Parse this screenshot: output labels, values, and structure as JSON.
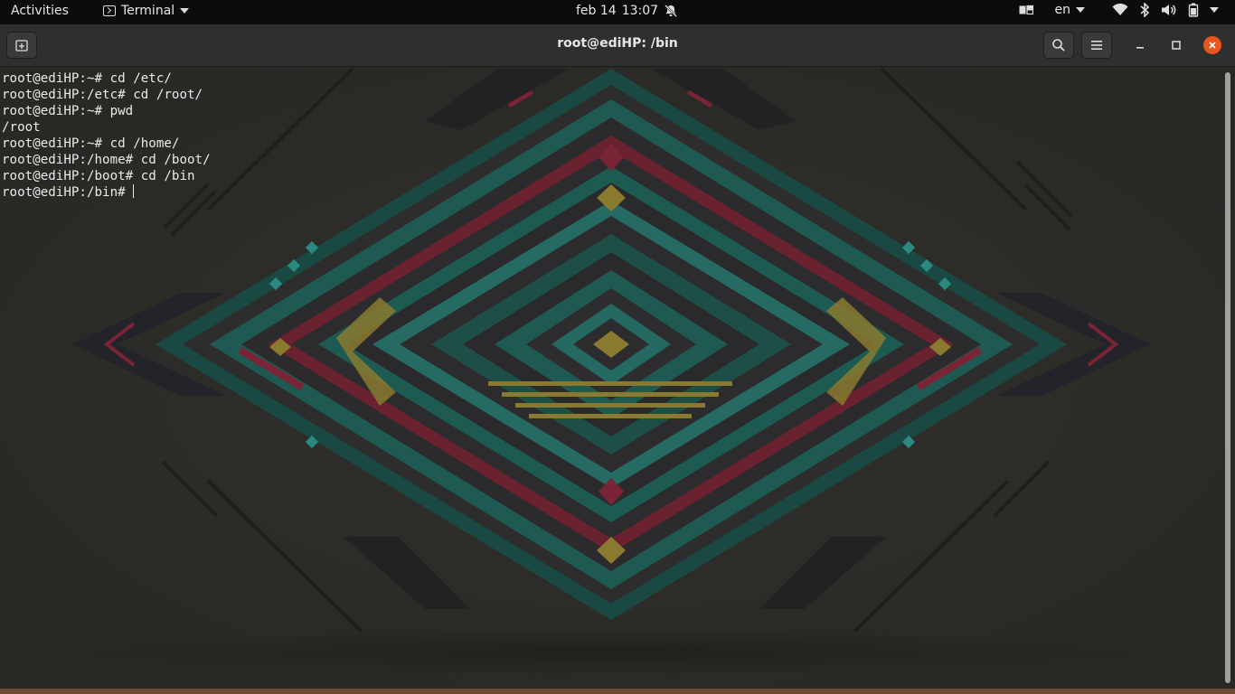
{
  "topbar": {
    "activities": "Activities",
    "app_name": "Terminal",
    "date": "feb 14",
    "time": "13:07",
    "keyboard_layout": "en",
    "icons": [
      "dnd-bell-icon",
      "display-icon",
      "wifi-icon",
      "bluetooth-icon",
      "volume-icon",
      "battery-icon",
      "power-menu-icon"
    ]
  },
  "window": {
    "title": "root@ediHP: /bin"
  },
  "terminal": {
    "lines": [
      "root@ediHP:~# cd /etc/",
      "root@ediHP:/etc# cd /root/",
      "root@ediHP:~# pwd",
      "/root",
      "root@ediHP:~# cd /home/",
      "root@ediHP:/home# cd /boot/",
      "root@ediHP:/boot# cd /bin",
      "root@ediHP:/bin# "
    ]
  },
  "colors": {
    "accent_close": "#e9541f",
    "terminal_text": "#eaeaea",
    "art_teal": "#1f5e55",
    "art_red": "#8a2a3a",
    "art_gold": "#8a7a30"
  }
}
